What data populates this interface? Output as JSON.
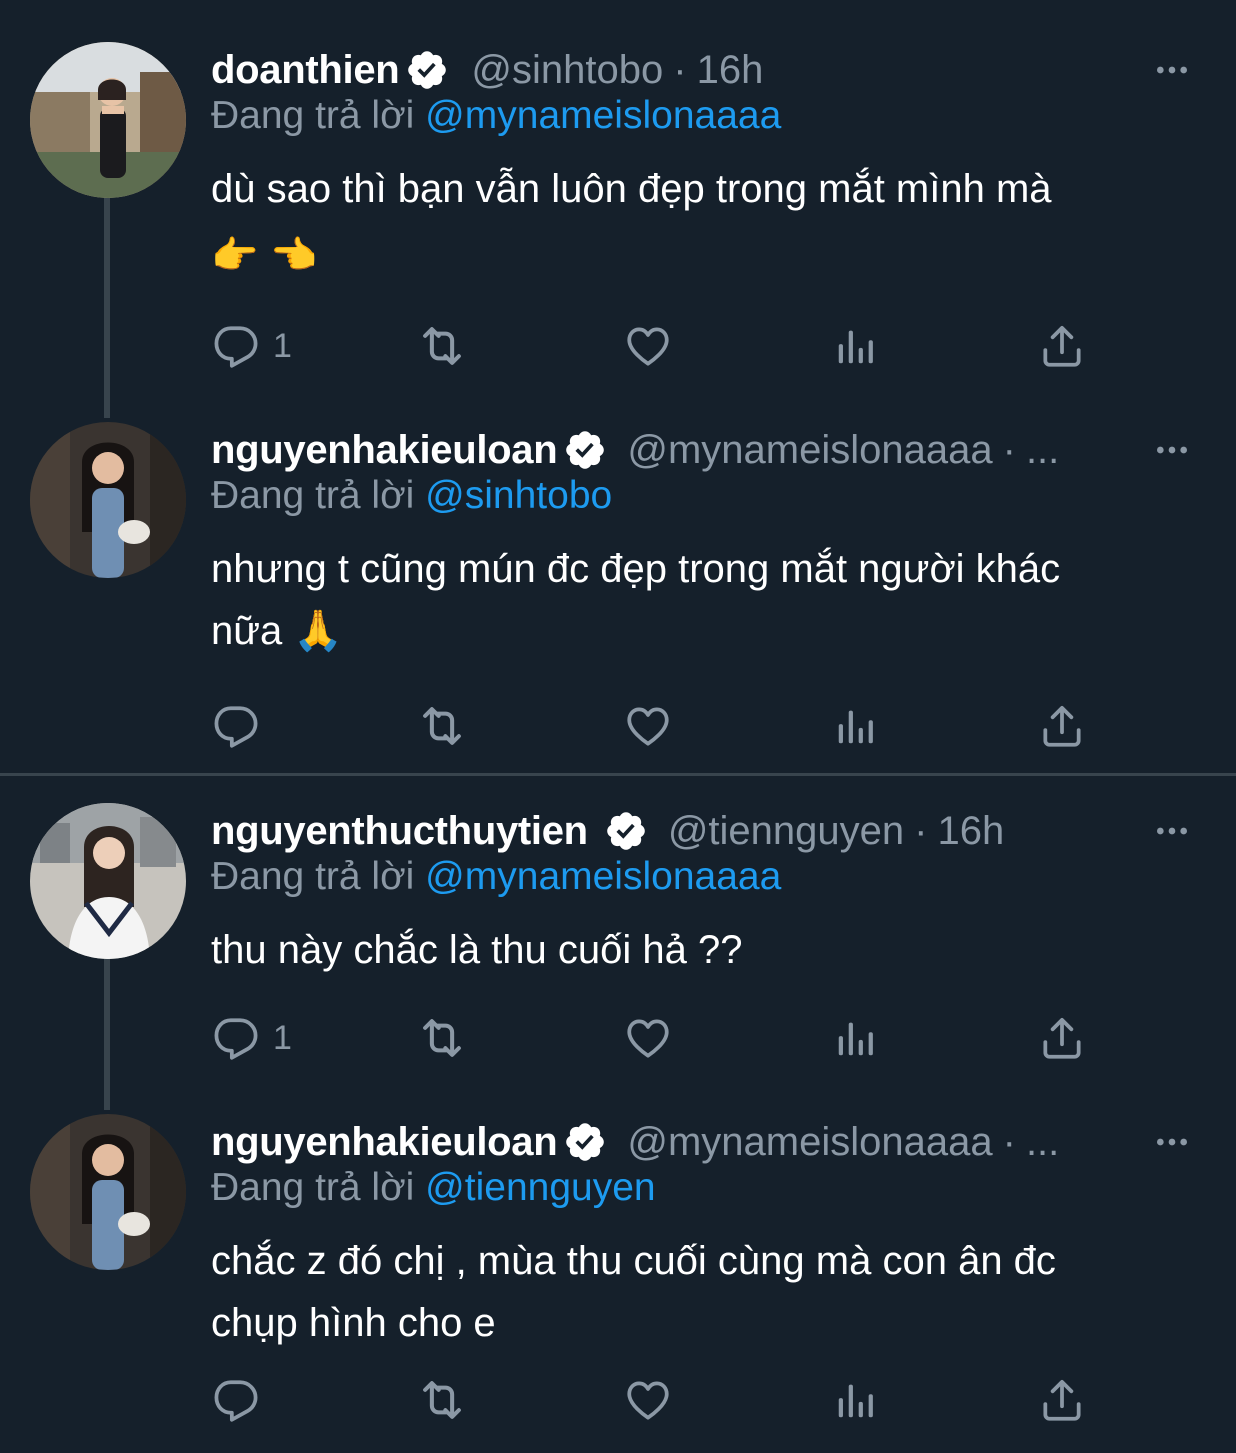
{
  "tweets": [
    {
      "name": "doanthien",
      "handle": "@sinhtobo",
      "time": "16h",
      "replying_label": "Đang trả lời",
      "replying_to": "@mynameislonaaaa",
      "text": "dù sao thì bạn vẫn luôn đẹp trong mắt mình mà",
      "emoji_line": "👉 👈",
      "reply_count": "1"
    },
    {
      "name": "nguyenhakieuloan",
      "handle": "@mynameislonaaaa",
      "time": "...",
      "replying_label": "Đang trả lời",
      "replying_to": "@sinhtobo",
      "text": "nhưng t cũng mún đc đẹp trong mắt người khác",
      "text_line2": "nữa 🙏",
      "reply_count": ""
    },
    {
      "name": "nguyenthucthuytien",
      "handle": "@tiennguyen",
      "time": "16h",
      "replying_label": "Đang trả lời",
      "replying_to": "@mynameislonaaaa",
      "text": "thu này chắc là thu cuối hả ??",
      "reply_count": "1"
    },
    {
      "name": "nguyenhakieuloan",
      "handle": "@mynameislonaaaa",
      "time": "...",
      "replying_label": "Đang trả lời",
      "replying_to": "@tiennguyen",
      "text": "chắc z đó chị , mùa thu cuối cùng mà con ân đc",
      "text_line2": "chụp hình cho e",
      "reply_count": ""
    }
  ],
  "separator": "·",
  "icons": {
    "reply": "reply-icon",
    "retweet": "retweet-icon",
    "like": "heart-icon",
    "views": "views-icon",
    "share": "share-icon",
    "more": "more-icon",
    "verified": "verified-badge-icon"
  },
  "colors": {
    "background": "#15202b",
    "text": "#ffffff",
    "muted": "#8b98a5",
    "link": "#1d9bf0",
    "divider": "#38444d"
  }
}
